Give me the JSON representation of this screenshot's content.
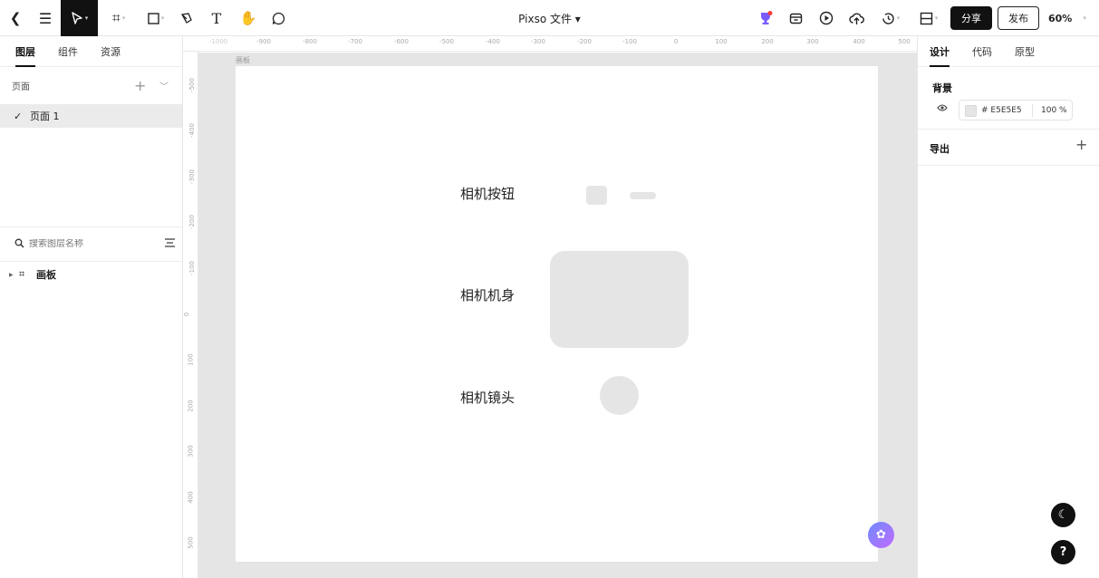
{
  "file": {
    "name": "Pixso 文件 ▾"
  },
  "toolbar": {
    "share_label": "分享",
    "publish_label": "发布",
    "zoom_label": "60%"
  },
  "left_panel": {
    "tabs": [
      {
        "label": "图层"
      },
      {
        "label": "组件"
      },
      {
        "label": "资源"
      }
    ],
    "pages_label": "页面",
    "pages": [
      {
        "name": "页面 1"
      }
    ],
    "search_placeholder": "搜索图层名称",
    "layers": [
      {
        "name": "画板"
      }
    ]
  },
  "rulers": {
    "horizontal": [
      "-1000",
      "-900",
      "-800",
      "-700",
      "-600",
      "-500",
      "-400",
      "-300",
      "-200",
      "-100",
      "0",
      "100",
      "200",
      "300",
      "400",
      "500"
    ],
    "vertical": [
      "-500",
      "-400",
      "-300",
      "-200",
      "-100",
      "0",
      "100",
      "200",
      "300",
      "400",
      "500"
    ]
  },
  "canvas": {
    "frame_label": "画板",
    "labels": {
      "button": "相机按钮",
      "body": "相机机身",
      "lens": "相机镜头"
    },
    "shape_color": "#E5E5E5"
  },
  "right_panel": {
    "tabs": [
      {
        "label": "设计"
      },
      {
        "label": "代码"
      },
      {
        "label": "原型"
      }
    ],
    "background_title": "背景",
    "background_hex": "# E5E5E5",
    "background_opacity": "100 %",
    "export_title": "导出"
  }
}
